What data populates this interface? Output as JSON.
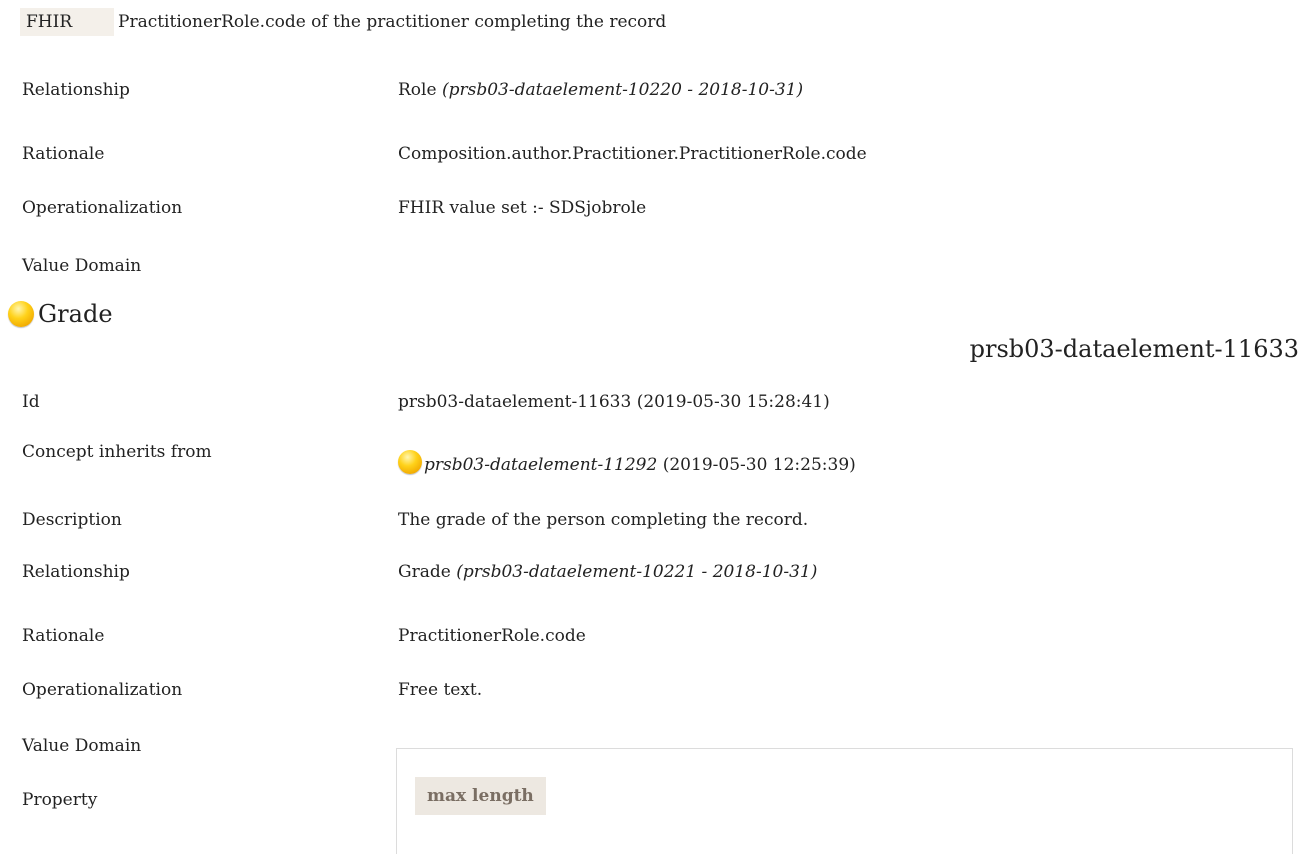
{
  "fhir": {
    "tag": "FHIR",
    "text": "PractitionerRole.code of the practitioner completing the record"
  },
  "role_section": {
    "relationship_label": "Relationship",
    "relationship_value": "Role",
    "relationship_ref": "(prsb03-dataelement-10220 - 2018-10-31)",
    "rationale_label": "Rationale",
    "rationale_value": "Composition.author.Practitioner.PractitionerRole.code",
    "operationalization_label": "Operationalization",
    "operationalization_value": "FHIR value set :- SDSjobrole",
    "value_domain_label": "Value Domain"
  },
  "grade": {
    "title": "Grade",
    "element_id": "prsb03-dataelement-11633",
    "id_label": "Id",
    "id_value": "prsb03-dataelement-11633 (2019-05-30 15:28:41)",
    "inherits_label": "Concept inherits from",
    "inherits_ref": "prsb03-dataelement-11292",
    "inherits_date": "(2019-05-30 12:25:39)",
    "description_label": "Description",
    "description_value": "The grade of the person completing the record.",
    "relationship_label": "Relationship",
    "relationship_value": "Grade",
    "relationship_ref": "(prsb03-dataelement-10221 - 2018-10-31)",
    "rationale_label": "Rationale",
    "rationale_value": "PractitionerRole.code",
    "operationalization_label": "Operationalization",
    "operationalization_value": "Free text.",
    "value_domain_label": "Value Domain",
    "property_label": "Property",
    "property_header": "max length"
  },
  "colors": {
    "orb": "#ffd21a",
    "fhir_tag_bg": "#f4f0ea",
    "prop_header_bg": "#ede8e1",
    "prop_header_text": "#7a6e63"
  },
  "icons": {
    "concept_status": "yellow-orb-icon"
  }
}
